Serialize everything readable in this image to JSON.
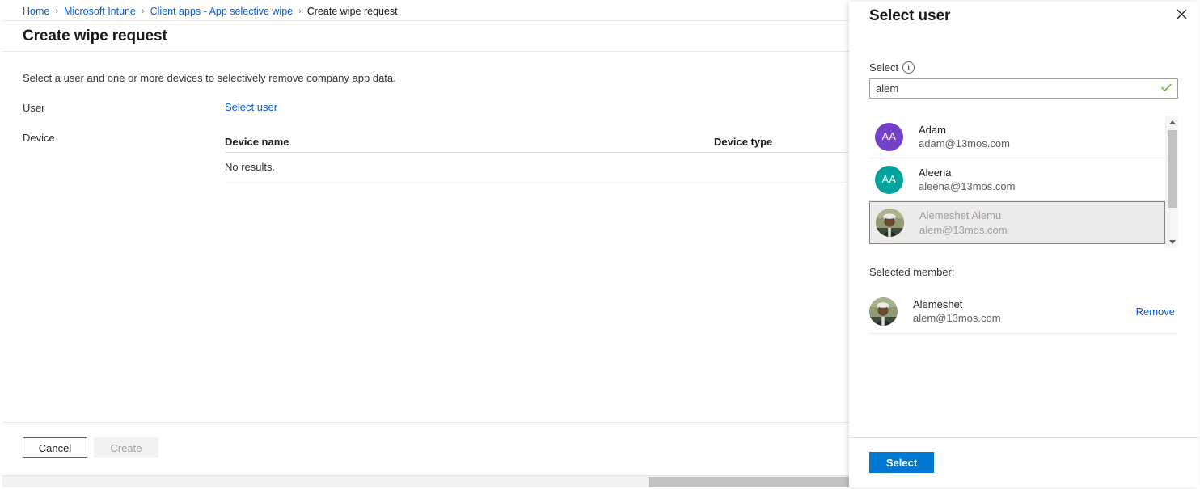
{
  "breadcrumb": {
    "items": [
      {
        "label": "Home",
        "link": true
      },
      {
        "label": "Microsoft Intune",
        "link": true
      },
      {
        "label": "Client apps - App selective wipe",
        "link": true
      },
      {
        "label": "Create wipe request",
        "link": false
      }
    ],
    "separator": "›"
  },
  "blade": {
    "title": "Create wipe request",
    "intro": "Select a user and one or more devices to selectively remove company app data.",
    "user": {
      "label": "User",
      "select_user_link": "Select user"
    },
    "device": {
      "label": "Device",
      "columns": [
        "Device name",
        "Device type"
      ],
      "rows": [],
      "empty_text": "No results."
    },
    "footer": {
      "cancel_label": "Cancel",
      "create_label": "Create",
      "create_disabled": true
    }
  },
  "pane": {
    "title": "Select user",
    "close_icon": "close-icon",
    "select_field": {
      "label": "Select",
      "info_icon": "info-icon",
      "value": "alem",
      "placeholder": "",
      "valid_icon": "checkmark-icon",
      "valid_color": "#5fb832"
    },
    "results": [
      {
        "name": "Adam",
        "email": "adam@13mos.com",
        "initials": "AA",
        "avatar_color": "#7340c8",
        "avatar_type": "initials",
        "selected": false
      },
      {
        "name": "Aleena",
        "email": "aleena@13mos.com",
        "initials": "AA",
        "avatar_color": "#03a39b",
        "avatar_type": "initials",
        "selected": false
      },
      {
        "name": "Alemeshet Alemu",
        "email": "alem@13mos.com",
        "initials": "",
        "avatar_color": "#6d7a5c",
        "avatar_type": "photo",
        "selected": true
      }
    ],
    "selected_member": {
      "label": "Selected member:",
      "name": "Alemeshet",
      "email": "alem@13mos.com",
      "avatar_type": "photo",
      "avatar_color": "#6d7a5c",
      "remove_label": "Remove"
    },
    "footer": {
      "select_label": "Select",
      "accent_color": "#0078d4"
    }
  },
  "scrollbars": {
    "horizontal_thumb_visible": true,
    "vertical_thumb_visible": true,
    "up_arrow_icon": "triangle-up-icon",
    "down_arrow_icon": "triangle-down-icon"
  }
}
